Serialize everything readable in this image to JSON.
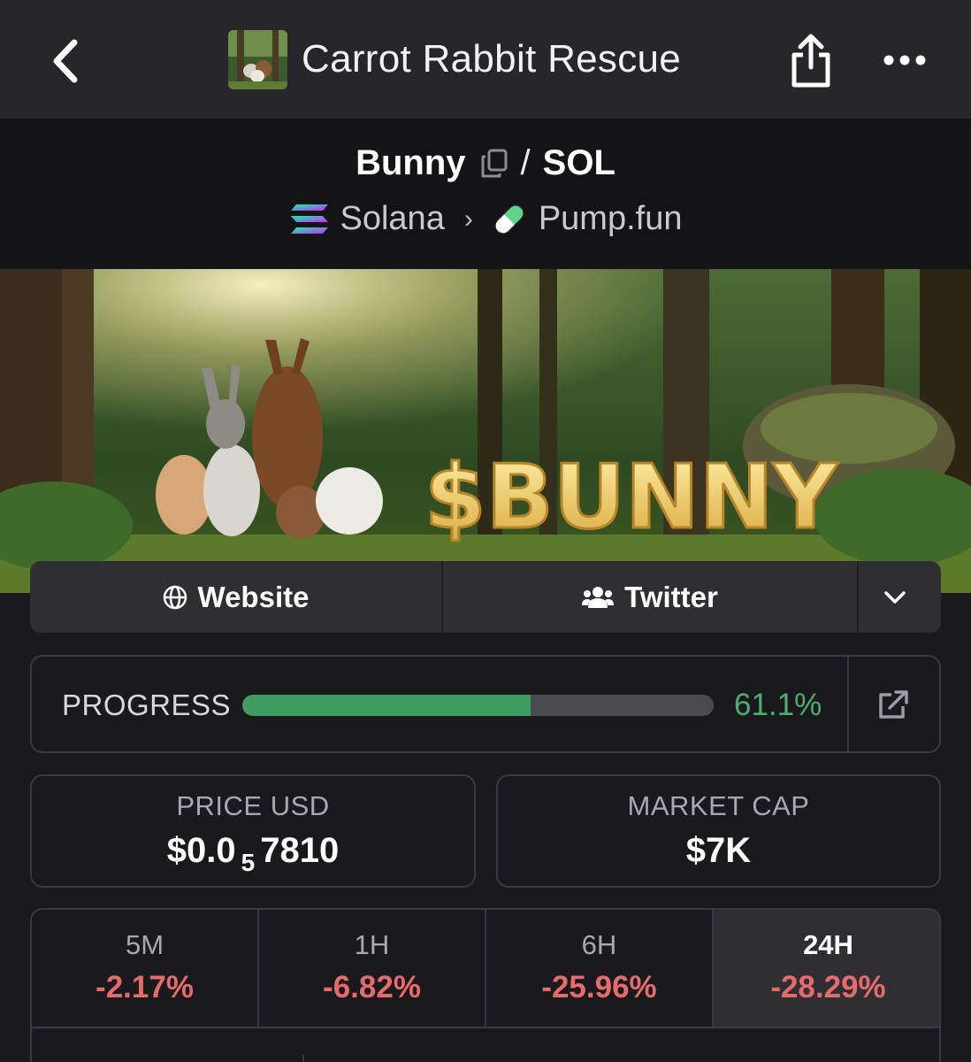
{
  "header": {
    "title": "Carrot Rabbit Rescue",
    "back_icon": "chevron-left-icon",
    "share_icon": "share-icon",
    "more_icon": "more-dots-icon"
  },
  "pair": {
    "base": "Bunny",
    "separator": "/",
    "quote": "SOL",
    "chain": "Solana",
    "dex": "Pump.fun"
  },
  "banner": {
    "text": "$BUNNY"
  },
  "links": {
    "website": "Website",
    "twitter": "Twitter"
  },
  "progress": {
    "label": "PROGRESS",
    "value": "61.1%",
    "fraction": 0.611
  },
  "stats": {
    "price": {
      "label": "PRICE USD",
      "prefix": "$0.0",
      "zeros": "5",
      "digits": "7810"
    },
    "market_cap": {
      "label": "MARKET CAP",
      "value": "$7K"
    }
  },
  "timeframes": [
    {
      "name": "5M",
      "change": "-2.17%"
    },
    {
      "name": "1H",
      "change": "-6.82%"
    },
    {
      "name": "6H",
      "change": "-25.96%"
    },
    {
      "name": "24H",
      "change": "-28.29%",
      "active": true
    }
  ],
  "colors": {
    "positive": "#4caf6e",
    "negative": "#e66c6c",
    "background": "#1a1a1e"
  }
}
